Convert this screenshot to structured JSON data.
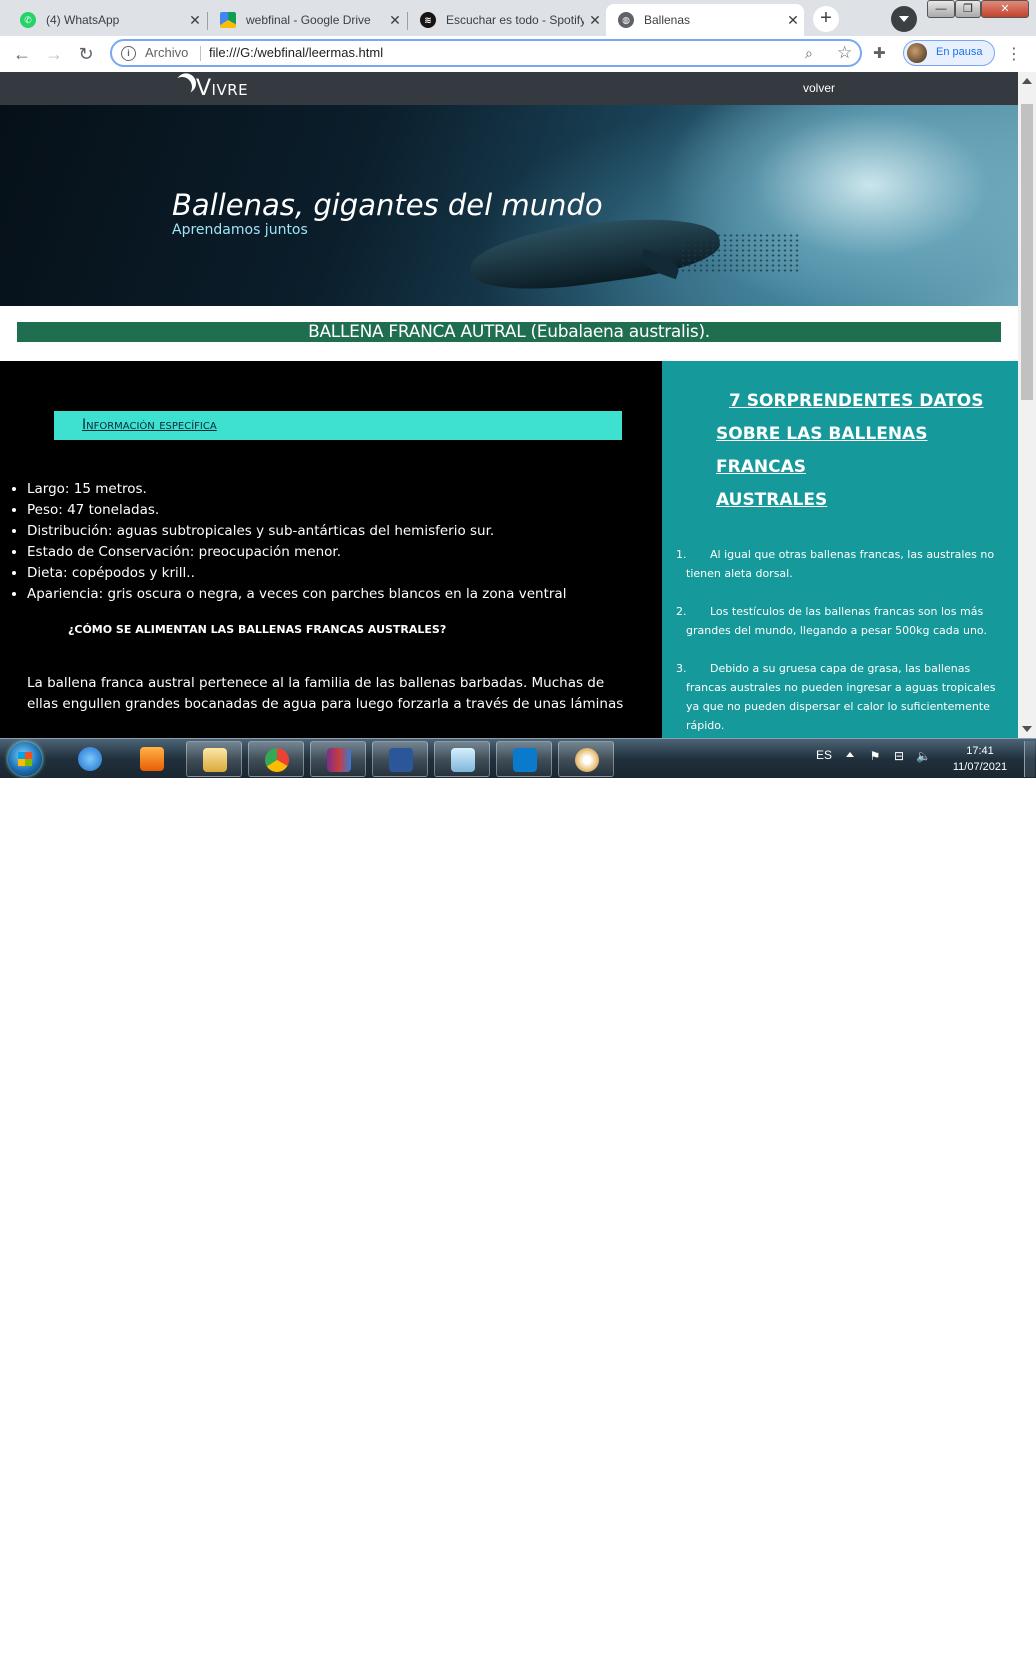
{
  "browser": {
    "tabs": [
      {
        "title": "(4) WhatsApp",
        "icon": "whatsapp-icon",
        "color": "#25d366"
      },
      {
        "title": "webfinal - Google Drive",
        "icon": "google-drive-icon",
        "color": "#fbbc04"
      },
      {
        "title": "Escuchar es todo - Spotify",
        "icon": "spotify-icon",
        "color": "#191414"
      },
      {
        "title": "Ballenas",
        "icon": "globe-icon",
        "color": "#5f6368",
        "active": true
      }
    ],
    "tab_close": "✕",
    "new_tab": "+",
    "address": {
      "security_label": "Archivo",
      "url": "file:///G:/webfinal/leermas.html"
    },
    "profile": {
      "status": "En pausa"
    }
  },
  "site": {
    "brand": "Vivre",
    "nav_link": "volver",
    "hero_title": "Ballenas, gigantes del mundo",
    "hero_subtitle": "Aprendamos juntos",
    "species_title": "BALLENA FRANCA AUTRAL (Eubalaena australis).",
    "info_heading": "Información específica",
    "facts": [
      "Largo: 15 metros.",
      "Peso: 47 toneladas.",
      "Distribución: aguas subtropicales y sub-antárticas del hemisferio sur.",
      "Estado de Conservación: preocupación menor.",
      "Dieta: copépodos y krill..",
      "Apariencia: gris oscura o negra, a veces con parches blancos en la zona ventral"
    ],
    "question_title": "¿CÓMO SE ALIMENTAN LAS BALLENAS FRANCAS AUSTRALES?",
    "paragraph": "La ballena franca austral pertenece al la familia de las ballenas barbadas. Muchas de ellas engullen grandes bocanadas de agua para luego forzarla a través de unas láminas",
    "sidebar_title_line1": "7 SORPRENDENTES DATOS",
    "sidebar_title_line2": "SOBRE LAS BALLENAS FRANCAS",
    "sidebar_title_line3": "AUSTRALES",
    "numbered_facts": [
      {
        "num": "1.",
        "text": "Al igual que otras ballenas francas, las australes no tienen aleta dorsal."
      },
      {
        "num": "2.",
        "text": "Los testículos de las ballenas francas son los más grandes del mundo, llegando a pesar 500kg cada uno."
      },
      {
        "num": "3.",
        "text": "Debido a su gruesa capa de grasa, las ballenas francas australes no pueden ingresar a aguas tropicales ya que no pueden dispersar el calor lo suficientemente rápido."
      }
    ]
  },
  "taskbar": {
    "language": "ES",
    "time": "17:41",
    "date": "11/07/2021",
    "apps": [
      "internet-explorer-icon",
      "media-player-icon",
      "file-explorer-icon",
      "chrome-icon",
      "winrar-icon",
      "word-icon",
      "notepad-icon",
      "vscode-icon",
      "paint-icon"
    ]
  }
}
